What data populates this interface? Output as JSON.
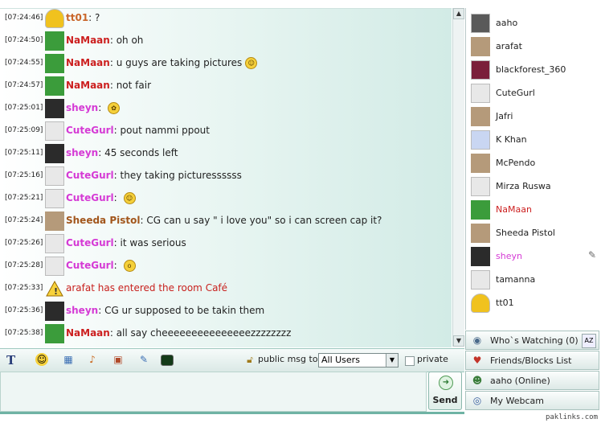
{
  "messages": [
    {
      "time": "[07:24:46]",
      "nick": "tt01",
      "nick_color": "#c9662a",
      "text": "?",
      "avatar": "mr-t-avatar"
    },
    {
      "time": "[07:24:50]",
      "nick": "NaMaan",
      "nick_color": "#cc1f1f",
      "text": "oh oh",
      "avatar": "green-hat-avatar"
    },
    {
      "time": "[07:24:55]",
      "nick": "NaMaan",
      "nick_color": "#cc1f1f",
      "text": "u guys are taking pictures",
      "emoticon": "grin-icon",
      "avatar": "green-hat-avatar"
    },
    {
      "time": "[07:24:57]",
      "nick": "NaMaan",
      "nick_color": "#cc1f1f",
      "text": "not fair",
      "avatar": "green-hat-avatar"
    },
    {
      "time": "[07:25:01]",
      "nick": "sheyn",
      "nick_color": "#d53ad5",
      "text": "",
      "emoticon": "flower-icon",
      "avatar": "dark-avatar"
    },
    {
      "time": "[07:25:09]",
      "nick": "CuteGurl",
      "nick_color": "#d53ad5",
      "text": "pout nammi ppout",
      "avatar": "blank-avatar"
    },
    {
      "time": "[07:25:11]",
      "nick": "sheyn",
      "nick_color": "#d53ad5",
      "text": "45 seconds left",
      "avatar": "dark-avatar"
    },
    {
      "time": "[07:25:16]",
      "nick": "CuteGurl",
      "nick_color": "#d53ad5",
      "text": "they taking picturessssss",
      "avatar": "blank-avatar"
    },
    {
      "time": "[07:25:21]",
      "nick": "CuteGurl",
      "nick_color": "#d53ad5",
      "text": "",
      "emoticon": "wink-icon",
      "avatar": "blank-avatar"
    },
    {
      "time": "[07:25:24]",
      "nick": "Sheeda Pistol",
      "nick_color": "#a2561c",
      "text": "CG can u say \" i love you\" so i can screen cap it?",
      "avatar": "photo-avatar"
    },
    {
      "time": "[07:25:26]",
      "nick": "CuteGurl",
      "nick_color": "#d53ad5",
      "text": "it was serious",
      "avatar": "blank-avatar"
    },
    {
      "time": "[07:25:28]",
      "nick": "CuteGurl",
      "nick_color": "#d53ad5",
      "text": "",
      "emoticon": "surprised-icon",
      "avatar": "blank-avatar"
    },
    {
      "time": "[07:25:33]",
      "system": "arafat has entered the room Café",
      "avatar": "warning-icon"
    },
    {
      "time": "[07:25:36]",
      "nick": "sheyn",
      "nick_color": "#d53ad5",
      "text": "CG ur supposed to be takin them",
      "avatar": "dark-avatar"
    },
    {
      "time": "[07:25:38]",
      "nick": "NaMaan",
      "nick_color": "#cc1f1f",
      "text": "all say cheeeeeeeeeeeeeeezzzzzzzz",
      "avatar": "green-hat-avatar"
    }
  ],
  "toolbar": {
    "text_format_label": "T",
    "public_msg_label": "public msg to:",
    "recipient_value": "All Users",
    "private_label": "private"
  },
  "send": {
    "label": "Send"
  },
  "users": [
    {
      "name": "aaho",
      "color": "#222222",
      "avatar": "person-avatar"
    },
    {
      "name": "arafat",
      "color": "#222222",
      "avatar": "photo-avatar"
    },
    {
      "name": "blackforest_360",
      "color": "#222222",
      "avatar": "red-avatar"
    },
    {
      "name": "CuteGurl",
      "color": "#222222",
      "avatar": "blank-avatar"
    },
    {
      "name": "Jafri",
      "color": "#222222",
      "avatar": "photo-avatar"
    },
    {
      "name": "K Khan",
      "color": "#222222",
      "avatar": "clock-avatar"
    },
    {
      "name": "McPendo",
      "color": "#222222",
      "avatar": "photo-avatar"
    },
    {
      "name": "Mirza Ruswa",
      "color": "#222222",
      "avatar": "blank-avatar"
    },
    {
      "name": "NaMaan",
      "color": "#cc1f1f",
      "avatar": "green-hat-avatar"
    },
    {
      "name": "Sheeda Pistol",
      "color": "#222222",
      "avatar": "photo-avatar"
    },
    {
      "name": "sheyn",
      "color": "#d53ad5",
      "avatar": "dark-avatar",
      "icon": "pen-icon"
    },
    {
      "name": "tamanna",
      "color": "#222222",
      "avatar": "blank-avatar"
    },
    {
      "name": "tt01",
      "color": "#222222",
      "avatar": "mr-t-avatar"
    }
  ],
  "panels": [
    {
      "label": "Who`s Watching (0)",
      "icon": "eye-icon"
    },
    {
      "label": "Friends/Blocks List",
      "icon": "friends-icon"
    },
    {
      "label": "aaho (Online)",
      "icon": "user-icon"
    },
    {
      "label": "My Webcam",
      "icon": "webcam-icon"
    }
  ],
  "footer": "paklinks.com"
}
